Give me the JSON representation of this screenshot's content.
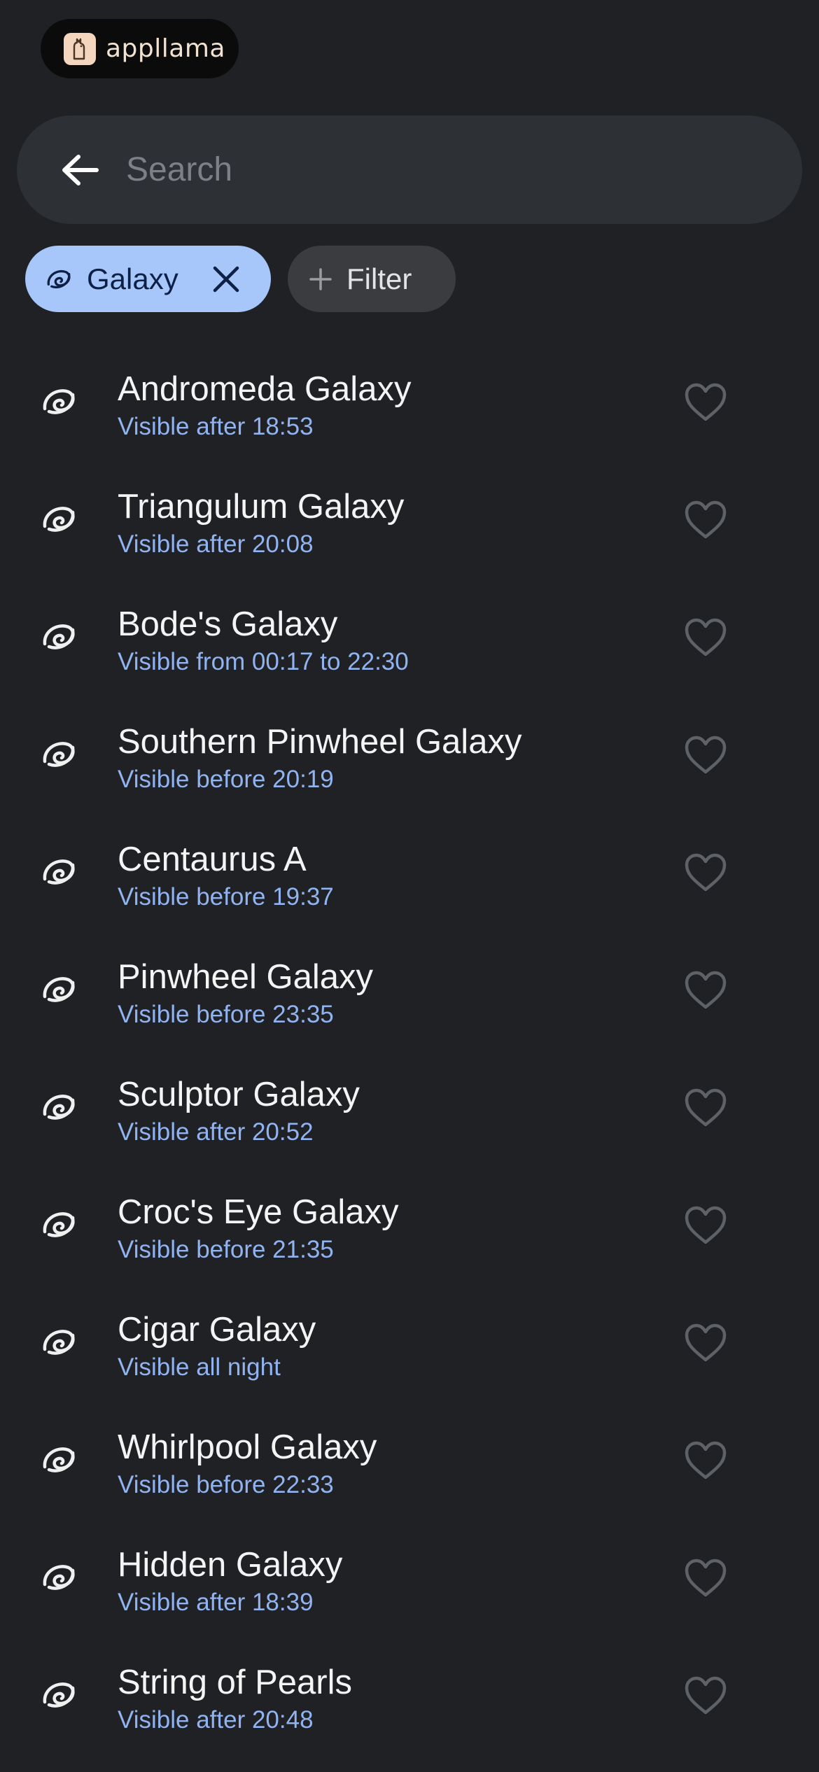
{
  "brand": {
    "name": "appllama"
  },
  "search": {
    "placeholder": "Search",
    "value": ""
  },
  "chips": {
    "active": {
      "label": "Galaxy",
      "icon": "galaxy-icon"
    },
    "filter": {
      "label": "Filter",
      "icon": "plus-icon"
    }
  },
  "colors": {
    "background": "#1f2125",
    "chip_active": "#a7c7fa",
    "subtitle": "#91b4f0"
  },
  "items": [
    {
      "title": "Andromeda Galaxy",
      "subtitle": "Visible after 18:53"
    },
    {
      "title": "Triangulum Galaxy",
      "subtitle": "Visible after 20:08"
    },
    {
      "title": "Bode's Galaxy",
      "subtitle": "Visible from 00:17 to 22:30"
    },
    {
      "title": "Southern Pinwheel Galaxy",
      "subtitle": "Visible before 20:19"
    },
    {
      "title": "Centaurus A",
      "subtitle": "Visible before 19:37"
    },
    {
      "title": "Pinwheel Galaxy",
      "subtitle": "Visible before 23:35"
    },
    {
      "title": "Sculptor Galaxy",
      "subtitle": "Visible after 20:52"
    },
    {
      "title": "Croc's Eye Galaxy",
      "subtitle": "Visible before 21:35"
    },
    {
      "title": "Cigar Galaxy",
      "subtitle": "Visible all night"
    },
    {
      "title": "Whirlpool Galaxy",
      "subtitle": "Visible before 22:33"
    },
    {
      "title": "Hidden Galaxy",
      "subtitle": "Visible after 18:39"
    },
    {
      "title": "String of Pearls",
      "subtitle": "Visible after 20:48"
    }
  ]
}
